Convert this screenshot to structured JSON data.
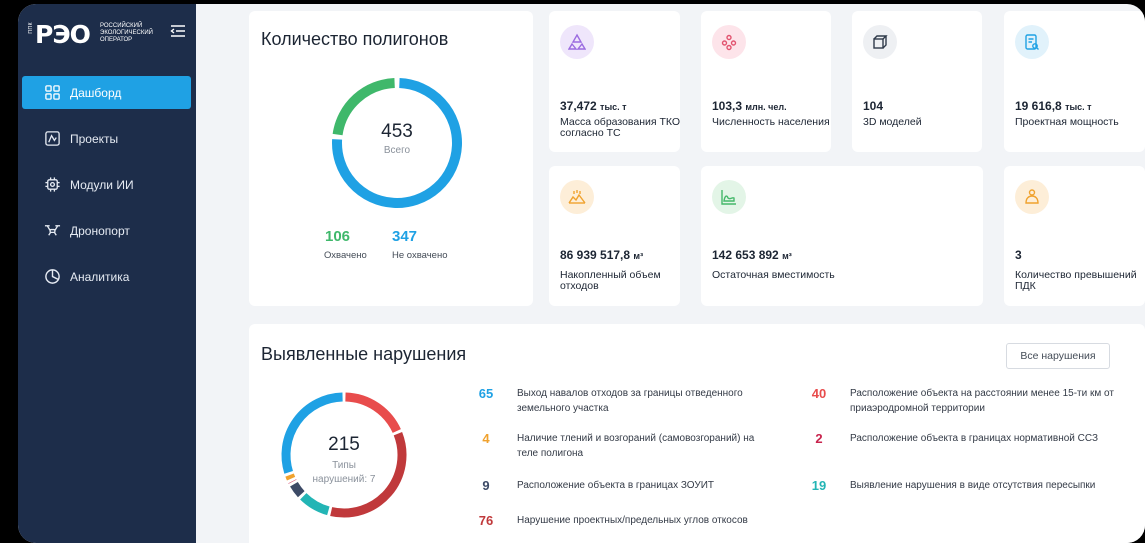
{
  "brand": {
    "vertical_text": "ППК",
    "name": "РЭО",
    "subtitle": "РОССИЙСКИЙ ЭКОЛОГИЧЕСКИЙ ОПЕРАТОР"
  },
  "nav": {
    "items": [
      {
        "label": "Дашборд",
        "icon": "grid-icon",
        "active": true
      },
      {
        "label": "Проекты",
        "icon": "map-icon"
      },
      {
        "label": "Модули ИИ",
        "icon": "chip-icon"
      },
      {
        "label": "Дронопорт",
        "icon": "drone-icon"
      },
      {
        "label": "Аналитика",
        "icon": "pie-chart-icon"
      }
    ]
  },
  "polygons": {
    "title": "Количество полигонов",
    "total": "453",
    "total_label": "Всего",
    "covered_value": "106",
    "covered_label": "Охвачено",
    "uncovered_value": "347",
    "uncovered_label": "Не охвачено",
    "covered_color": "#3fb86b",
    "uncovered_color": "#1fa1e4",
    "covered_fraction": 0.234
  },
  "stats": [
    {
      "value": "37,472",
      "unit": "тыс. т",
      "label": "Масса образования ТКО согласно ТС",
      "icon": "recycle-icon",
      "icon_bg": "#efe6fb",
      "icon_color": "#9b6be0"
    },
    {
      "value": "103,3",
      "unit": "млн. чел.",
      "label": "Численность населения",
      "icon": "people-icon",
      "icon_bg": "#fde4ea",
      "icon_color": "#e2536f"
    },
    {
      "value": "104",
      "unit": "",
      "label": "3D моделей",
      "icon": "cube-icon",
      "icon_bg": "#eef0f3",
      "icon_color": "#2f3a4a"
    },
    {
      "value": "19 616,8",
      "unit": "тыс. т",
      "label": "Проектная мощность",
      "icon": "document-search-icon",
      "icon_bg": "#e1f2fb",
      "icon_color": "#1fa1e4"
    },
    {
      "value": "86 939 517,8",
      "unit": "м³",
      "label": "Накопленный объем отходов",
      "icon": "waste-pile-icon",
      "icon_bg": "#fdeed8",
      "icon_color": "#f0a22e"
    },
    {
      "value": "142 653 892",
      "unit": "м³",
      "label": "Остаточная вместимость",
      "icon": "area-chart-icon",
      "icon_bg": "#e3f5e7",
      "icon_color": "#45b86a"
    },
    {
      "value": "3",
      "unit": "",
      "label": "Количество превышений ПДК",
      "icon": "alert-icon",
      "icon_bg": "#fdeed8",
      "icon_color": "#f0a22e"
    }
  ],
  "violations": {
    "title": "Выявленные нарушения",
    "all_button": "Все нарушения",
    "total": "215",
    "types_label": "Типы нарушений: 7",
    "items": [
      {
        "count": "65",
        "label": "Выход навалов отходов за границы отведенного земельного участка",
        "color": "#1fa1e4",
        "value": 65
      },
      {
        "count": "40",
        "label": "Расположение объекта на расстоянии менее 15-ти км от приаэродромной территории",
        "color": "#e84c4c",
        "value": 40
      },
      {
        "count": "4",
        "label": "Наличие тлений и возгораний (самовозгораний) на теле полигона",
        "color": "#f0a22e",
        "value": 4
      },
      {
        "count": "2",
        "label": "Расположение объекта в границах нормативной ССЗ",
        "color": "#c8244d",
        "value": 2
      },
      {
        "count": "9",
        "label": "Расположение объекта в границах ЗОУИТ",
        "color": "#3c4a66",
        "value": 9
      },
      {
        "count": "19",
        "label": "Выявление нарушения в виде отсутствия пересыпки",
        "color": "#23b5b5",
        "value": 19
      },
      {
        "count": "76",
        "label": "Нарушение проектных/предельных углов откосов",
        "color": "#c0393b",
        "value": 76
      }
    ]
  }
}
